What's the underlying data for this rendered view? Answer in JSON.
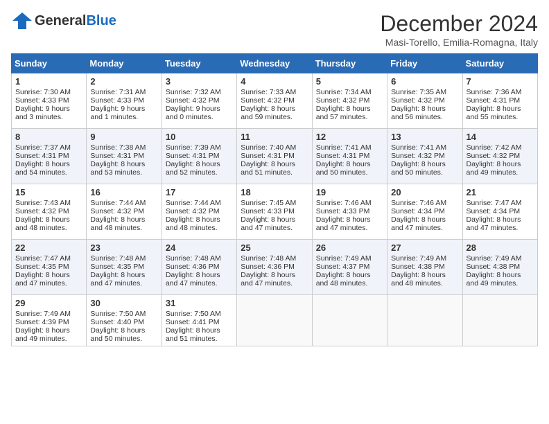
{
  "logo": {
    "general": "General",
    "blue": "Blue"
  },
  "title": "December 2024",
  "location": "Masi-Torello, Emilia-Romagna, Italy",
  "days_of_week": [
    "Sunday",
    "Monday",
    "Tuesday",
    "Wednesday",
    "Thursday",
    "Friday",
    "Saturday"
  ],
  "weeks": [
    [
      {
        "day": "1",
        "sunrise": "7:30 AM",
        "sunset": "4:33 PM",
        "daylight_h": "9",
        "daylight_m": "3"
      },
      {
        "day": "2",
        "sunrise": "7:31 AM",
        "sunset": "4:33 PM",
        "daylight_h": "9",
        "daylight_m": "1"
      },
      {
        "day": "3",
        "sunrise": "7:32 AM",
        "sunset": "4:32 PM",
        "daylight_h": "9",
        "daylight_m": "0"
      },
      {
        "day": "4",
        "sunrise": "7:33 AM",
        "sunset": "4:32 PM",
        "daylight_h": "8",
        "daylight_m": "59"
      },
      {
        "day": "5",
        "sunrise": "7:34 AM",
        "sunset": "4:32 PM",
        "daylight_h": "8",
        "daylight_m": "57"
      },
      {
        "day": "6",
        "sunrise": "7:35 AM",
        "sunset": "4:32 PM",
        "daylight_h": "8",
        "daylight_m": "56"
      },
      {
        "day": "7",
        "sunrise": "7:36 AM",
        "sunset": "4:31 PM",
        "daylight_h": "8",
        "daylight_m": "55"
      }
    ],
    [
      {
        "day": "8",
        "sunrise": "7:37 AM",
        "sunset": "4:31 PM",
        "daylight_h": "8",
        "daylight_m": "54"
      },
      {
        "day": "9",
        "sunrise": "7:38 AM",
        "sunset": "4:31 PM",
        "daylight_h": "8",
        "daylight_m": "53"
      },
      {
        "day": "10",
        "sunrise": "7:39 AM",
        "sunset": "4:31 PM",
        "daylight_h": "8",
        "daylight_m": "52"
      },
      {
        "day": "11",
        "sunrise": "7:40 AM",
        "sunset": "4:31 PM",
        "daylight_h": "8",
        "daylight_m": "51"
      },
      {
        "day": "12",
        "sunrise": "7:41 AM",
        "sunset": "4:31 PM",
        "daylight_h": "8",
        "daylight_m": "50"
      },
      {
        "day": "13",
        "sunrise": "7:41 AM",
        "sunset": "4:32 PM",
        "daylight_h": "8",
        "daylight_m": "50"
      },
      {
        "day": "14",
        "sunrise": "7:42 AM",
        "sunset": "4:32 PM",
        "daylight_h": "8",
        "daylight_m": "49"
      }
    ],
    [
      {
        "day": "15",
        "sunrise": "7:43 AM",
        "sunset": "4:32 PM",
        "daylight_h": "8",
        "daylight_m": "48"
      },
      {
        "day": "16",
        "sunrise": "7:44 AM",
        "sunset": "4:32 PM",
        "daylight_h": "8",
        "daylight_m": "48"
      },
      {
        "day": "17",
        "sunrise": "7:44 AM",
        "sunset": "4:32 PM",
        "daylight_h": "8",
        "daylight_m": "48"
      },
      {
        "day": "18",
        "sunrise": "7:45 AM",
        "sunset": "4:33 PM",
        "daylight_h": "8",
        "daylight_m": "47"
      },
      {
        "day": "19",
        "sunrise": "7:46 AM",
        "sunset": "4:33 PM",
        "daylight_h": "8",
        "daylight_m": "47"
      },
      {
        "day": "20",
        "sunrise": "7:46 AM",
        "sunset": "4:34 PM",
        "daylight_h": "8",
        "daylight_m": "47"
      },
      {
        "day": "21",
        "sunrise": "7:47 AM",
        "sunset": "4:34 PM",
        "daylight_h": "8",
        "daylight_m": "47"
      }
    ],
    [
      {
        "day": "22",
        "sunrise": "7:47 AM",
        "sunset": "4:35 PM",
        "daylight_h": "8",
        "daylight_m": "47"
      },
      {
        "day": "23",
        "sunrise": "7:48 AM",
        "sunset": "4:35 PM",
        "daylight_h": "8",
        "daylight_m": "47"
      },
      {
        "day": "24",
        "sunrise": "7:48 AM",
        "sunset": "4:36 PM",
        "daylight_h": "8",
        "daylight_m": "47"
      },
      {
        "day": "25",
        "sunrise": "7:48 AM",
        "sunset": "4:36 PM",
        "daylight_h": "8",
        "daylight_m": "47"
      },
      {
        "day": "26",
        "sunrise": "7:49 AM",
        "sunset": "4:37 PM",
        "daylight_h": "8",
        "daylight_m": "48"
      },
      {
        "day": "27",
        "sunrise": "7:49 AM",
        "sunset": "4:38 PM",
        "daylight_h": "8",
        "daylight_m": "48"
      },
      {
        "day": "28",
        "sunrise": "7:49 AM",
        "sunset": "4:38 PM",
        "daylight_h": "8",
        "daylight_m": "49"
      }
    ],
    [
      {
        "day": "29",
        "sunrise": "7:49 AM",
        "sunset": "4:39 PM",
        "daylight_h": "8",
        "daylight_m": "49"
      },
      {
        "day": "30",
        "sunrise": "7:50 AM",
        "sunset": "4:40 PM",
        "daylight_h": "8",
        "daylight_m": "50"
      },
      {
        "day": "31",
        "sunrise": "7:50 AM",
        "sunset": "4:41 PM",
        "daylight_h": "8",
        "daylight_m": "51"
      },
      null,
      null,
      null,
      null
    ]
  ]
}
